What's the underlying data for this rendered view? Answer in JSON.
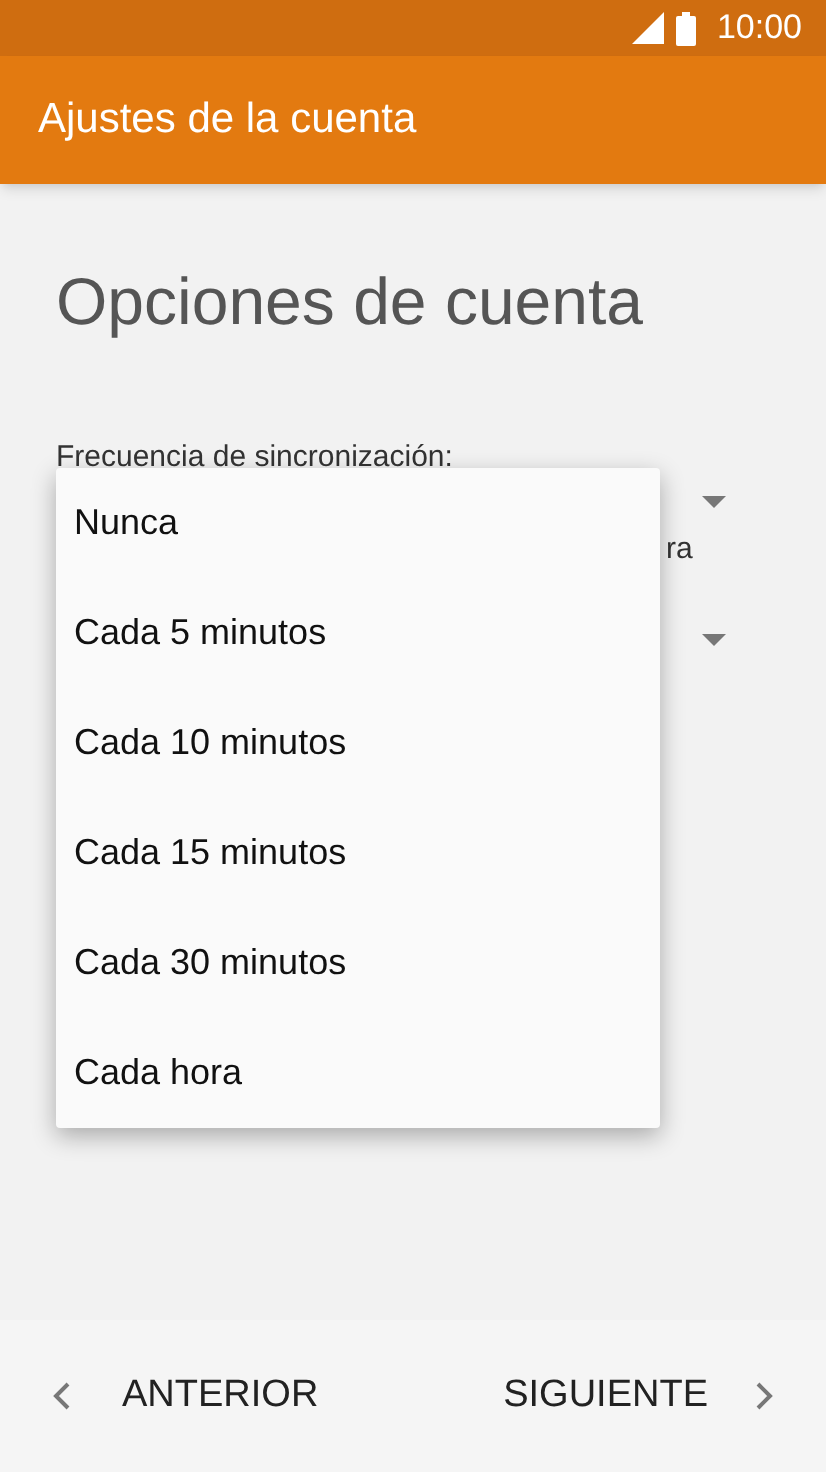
{
  "status_bar": {
    "time": "10:00"
  },
  "app_bar": {
    "title": "Ajustes de la cuenta"
  },
  "heading": "Opciones de cuenta",
  "sync_label": "Frecuencia de sincronización:",
  "partial_label": "ra",
  "dropdown_menu": {
    "items": [
      {
        "label": "Nunca"
      },
      {
        "label": "Cada 5 minutos"
      },
      {
        "label": "Cada 10 minutos"
      },
      {
        "label": "Cada 15 minutos"
      },
      {
        "label": "Cada 30 minutos"
      },
      {
        "label": "Cada hora"
      }
    ]
  },
  "nav": {
    "back": "ANTERIOR",
    "next": "SIGUIENTE"
  }
}
